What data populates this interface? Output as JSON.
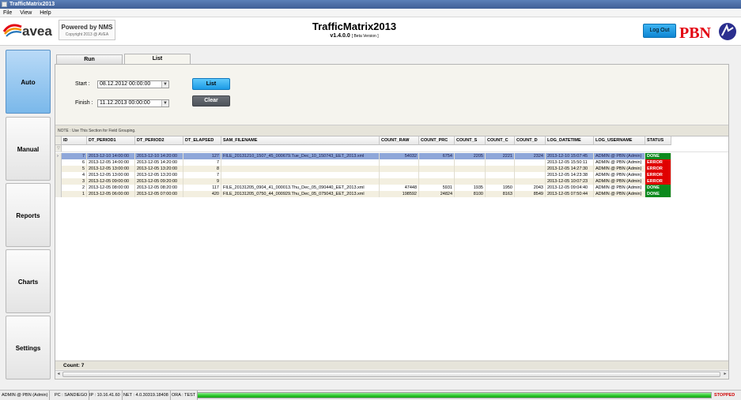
{
  "window": {
    "title": "TrafficMatrix2013"
  },
  "menu": [
    "File",
    "View",
    "Help"
  ],
  "header": {
    "logo_text": "avea",
    "powered_by": "Powered by NMS",
    "copyright": "Copyright 2013 @ AVEA",
    "app_title": "TrafficMatrix2013",
    "version": "v1.4.0.0",
    "version_note": "[ Beta Version ]",
    "logout_label": "Log Out",
    "brand_logo": "PBN"
  },
  "sidebar": [
    "Auto",
    "Manual",
    "Reports",
    "Charts",
    "Settings"
  ],
  "tabs": [
    "Run",
    "List"
  ],
  "filters": {
    "start_label": "Start :",
    "start_value": "08.12.2012 00:00:00",
    "finish_label": "Finish :",
    "finish_value": "11.12.2013 00:00:00",
    "list_button": "List",
    "clear_button": "Clear"
  },
  "group_note": "NOTE : Use This Section for Field Grouping.",
  "grid": {
    "columns": [
      "ID",
      "DT_PERIOD1",
      "DT_PERIOD2",
      "DT_ELAPSED",
      "SAM_FILENAME",
      "COUNT_RAW",
      "COUNT_PRC",
      "COUNT_S",
      "COUNT_C",
      "COUNT_D",
      "LOG_DATETIME",
      "LOG_USERNAME",
      "STATUS"
    ],
    "rows": [
      [
        "7",
        "2013-12-10 14:00:00",
        "2013-12-10 14:20:00",
        "127",
        "FILE_20131210_1507_45_000679.Tue_Dec_10_150743_EET_2013.xml",
        "54032",
        "6754",
        "2205",
        "2221",
        "2324",
        "2013-12-10 15:07:45",
        "ADMIN @ PBN (Admin)",
        "DONE"
      ],
      [
        "6",
        "2013-12-05 14:00:00",
        "2013-12-05 14:20:00",
        "7",
        "",
        "",
        "",
        "",
        "",
        "",
        "2013-12-05 15:50:11",
        "ADMIN @ PBN (Admin)",
        "ERROR"
      ],
      [
        "5",
        "2013-12-05 13:00:00",
        "2013-12-05 13:20:00",
        "8",
        "",
        "",
        "",
        "",
        "",
        "",
        "2013-12-05 14:27:30",
        "ADMIN @ PBN (Admin)",
        "ERROR"
      ],
      [
        "4",
        "2013-12-05 13:00:00",
        "2013-12-05 13:20:00",
        "7",
        "",
        "",
        "",
        "",
        "",
        "",
        "2013-12-05 14:23:38",
        "ADMIN @ PBN (Admin)",
        "ERROR"
      ],
      [
        "3",
        "2013-12-05 09:00:00",
        "2013-12-05 09:20:00",
        "9",
        "",
        "",
        "",
        "",
        "",
        "",
        "2013-12-05 10:07:23",
        "ADMIN @ PBN (Admin)",
        "ERROR"
      ],
      [
        "2",
        "2013-12-05 08:00:00",
        "2013-12-05 08:20:00",
        "117",
        "FILE_20131205_0904_41_000013.Thu_Dec_05_090440_EET_2013.xml",
        "47448",
        "5931",
        "1935",
        "1950",
        "2043",
        "2013-12-05 09:04:40",
        "ADMIN @ PBN (Admin)",
        "DONE"
      ],
      [
        "1",
        "2013-12-05 06:00:00",
        "2013-12-05 07:00:00",
        "420",
        "FILE_20131205_0750_44_000929.Thu_Dec_05_075043_EET_2013.xml",
        "198592",
        "24824",
        "8100",
        "8163",
        "8549",
        "2013-12-05 07:50:44",
        "ADMIN @ PBN (Admin)",
        "DONE"
      ]
    ],
    "selected_row_marker": "›",
    "count_label": "Count: 7"
  },
  "statusbar": {
    "user": "ADMIN @ PBN (Admin)",
    "pc": "PC : SANDIEGO",
    "ip": "IP : 10.16.41.60",
    "net": "NET : 4.0.30319.18408",
    "ora": "ORA : TEST",
    "progress": 1.0,
    "state": "STOPPED"
  },
  "colors": {
    "accent": "#1c9be6",
    "done": "#0b8a1d",
    "error": "#e00000",
    "selected_row": "#8fa7d9",
    "stopped": "#d00000"
  }
}
